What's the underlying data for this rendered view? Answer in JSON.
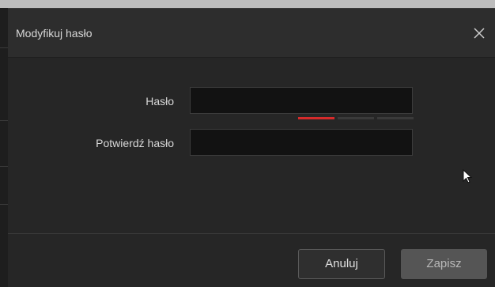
{
  "dialog": {
    "title": "Modyfikuj hasło",
    "close_icon": "close-icon"
  },
  "form": {
    "password_label": "Hasło",
    "password_value": "",
    "confirm_label": "Potwierdź hasło",
    "confirm_value": "",
    "strength": {
      "level": 1,
      "of": 3,
      "colors": [
        "#d62b2b",
        "#3a3a3a",
        "#3a3a3a"
      ]
    }
  },
  "buttons": {
    "cancel_label": "Anuluj",
    "save_label": "Zapisz"
  },
  "colors": {
    "dialog_bg": "#262626",
    "header_bg": "#2d2d2d",
    "input_bg": "#121212",
    "strength_weak": "#d62b2b",
    "save_disabled_bg": "#555555"
  },
  "pointer_icon": "mouse-pointer-icon"
}
